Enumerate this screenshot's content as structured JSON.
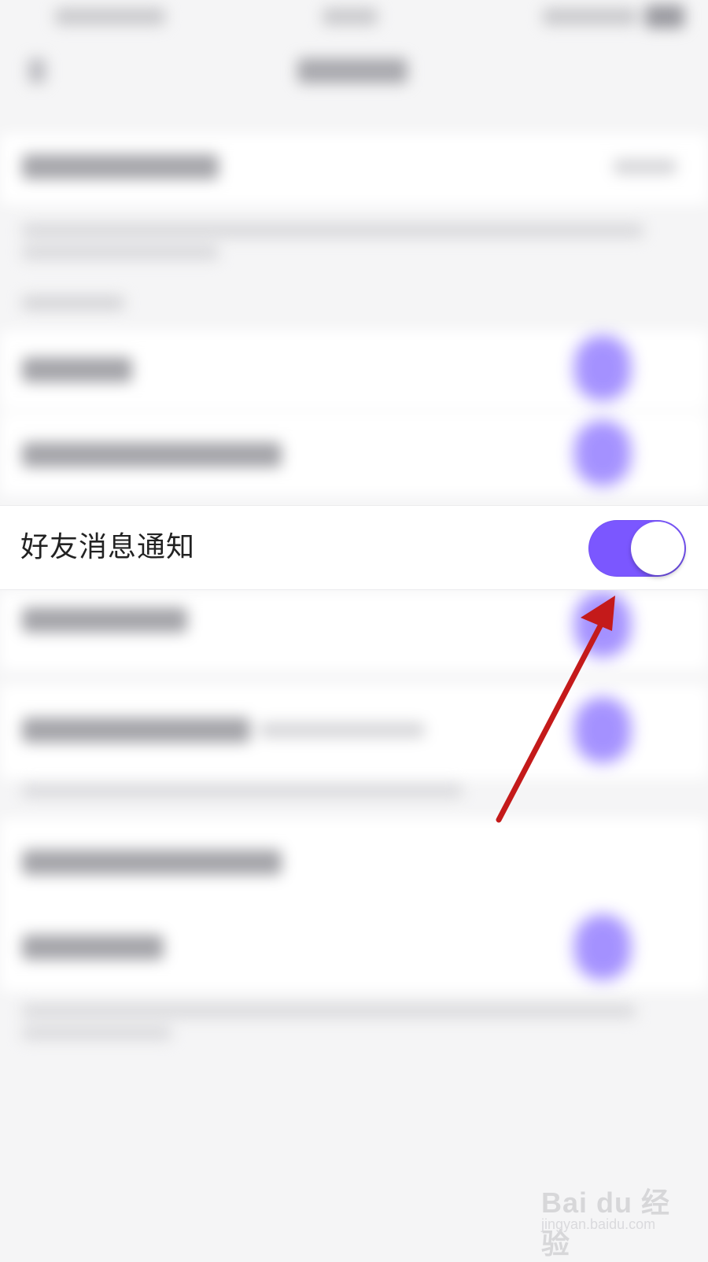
{
  "focused_setting": {
    "label": "好友消息通知",
    "toggle_on": true
  },
  "colors": {
    "accent": "#7b57ff",
    "arrow": "#c41a1a",
    "background": "#f5f5f6"
  },
  "icons": [
    "back-icon",
    "signal-icon",
    "battery-icon"
  ],
  "watermark": {
    "brand": "Bai du 经验",
    "url": "jingyan.baidu.com"
  }
}
